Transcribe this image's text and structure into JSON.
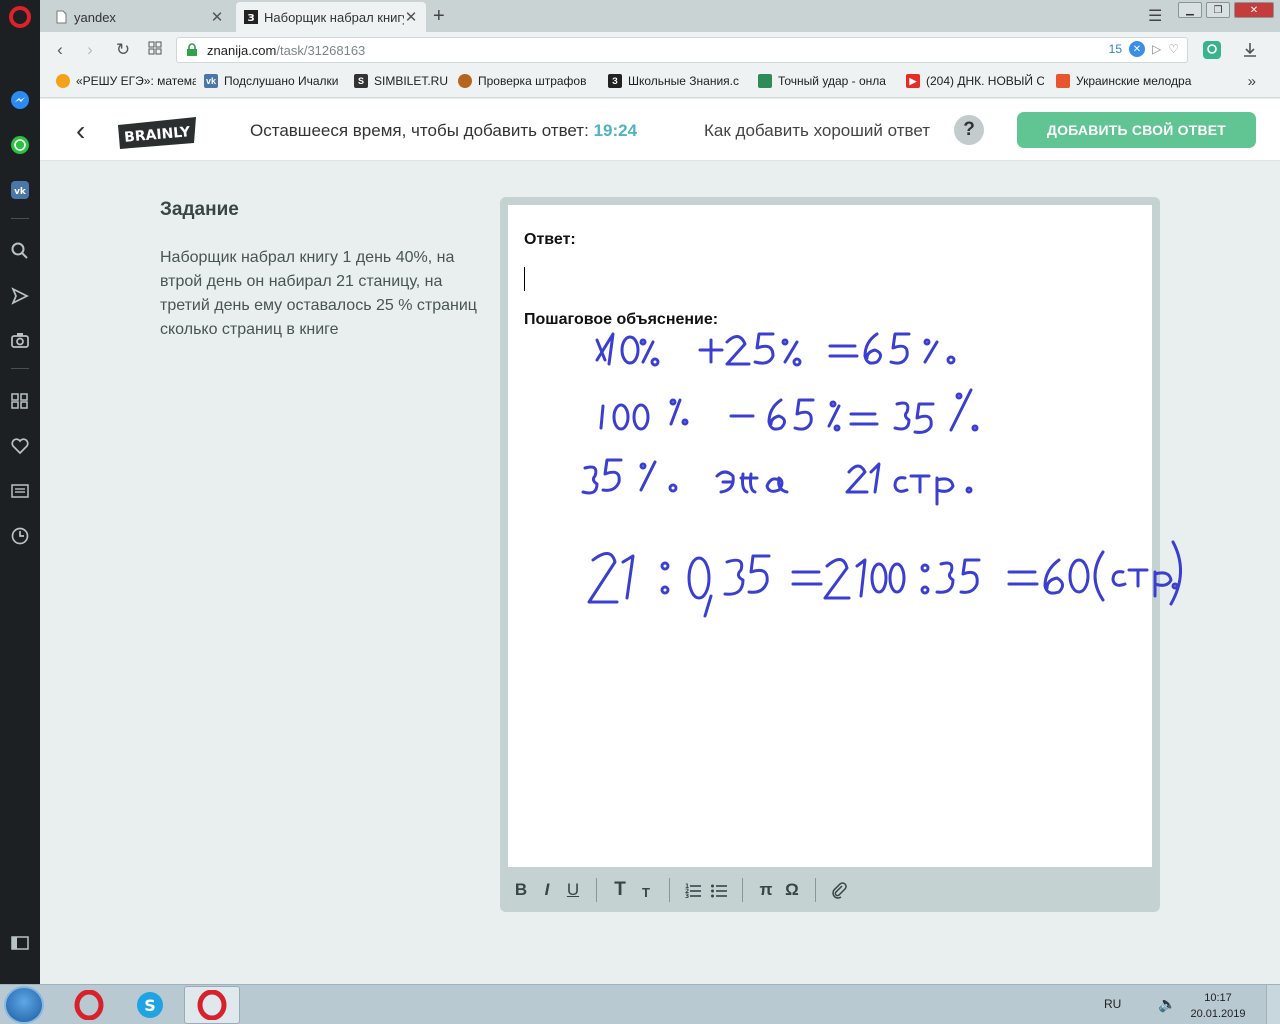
{
  "browser": {
    "tabs": [
      {
        "title": "yandex",
        "active": false
      },
      {
        "title": "Наборщик набрал книгу",
        "active": true
      }
    ],
    "url_host": "znanija.com",
    "url_path": "/task/31268163",
    "vpn_count": "15",
    "bookmarks": [
      {
        "label": "«РЕШУ ЕГЭ»: матема",
        "icon": "reshu-icon",
        "color": "#f4a21b"
      },
      {
        "label": "Подслушано Ичалки",
        "icon": "vk-icon",
        "color": "#4a76a8"
      },
      {
        "label": "SIMBILET.RU",
        "icon": "simbilet-icon",
        "color": "#333333"
      },
      {
        "label": "Проверка штрафов",
        "icon": "emblem-icon",
        "color": "#b5651d"
      },
      {
        "label": "Школьные Знания.c",
        "icon": "znanija-icon",
        "color": "#222222"
      },
      {
        "label": "Точный удар - онла",
        "icon": "game-icon",
        "color": "#2e8b57"
      },
      {
        "label": "(204) ДНК. НОВЫЙ С",
        "icon": "youtube-icon",
        "color": "#e52d27"
      },
      {
        "label": "Украинские мелодра",
        "icon": "chart-icon",
        "color": "#e8542e"
      }
    ]
  },
  "header": {
    "logo_text": "BRAINLY",
    "time_label": "Оставшееся время, чтобы добавить ответ:",
    "time_value": "19:24",
    "howto_label": "Как добавить хороший ответ",
    "help_symbol": "?",
    "add_answer_label": "ДОБАВИТЬ СВОЙ ОТВЕТ"
  },
  "task": {
    "title": "Задание",
    "text": "Наборщик набрал книгу 1 день 40%, на втрой день он набирал 21 станицу, на третий день ему оставалось 25 % страниц сколько страниц в книге"
  },
  "editor": {
    "answer_label": "Ответ:",
    "step_label": "Пошаговое объяснение:",
    "handwriting_lines": [
      "40% + 25% = 65%",
      "100% - 65% = 35%",
      "35% это 21 стр.",
      "21 : 0,35 = 2100 : 35 = 60 (стр.)"
    ],
    "ink_color": "#3a3fd0",
    "toolbar": {
      "bold": "B",
      "italic": "I",
      "underline": "U",
      "text_big": "T",
      "text_small": "T",
      "pi": "π",
      "omega": "Ω"
    }
  },
  "taskbar": {
    "lang": "RU",
    "time": "10:17",
    "date": "20.01.2019"
  },
  "colors": {
    "accent_green": "#60c593",
    "accent_teal": "#4fb3bf",
    "opera_red": "#e0202b"
  }
}
